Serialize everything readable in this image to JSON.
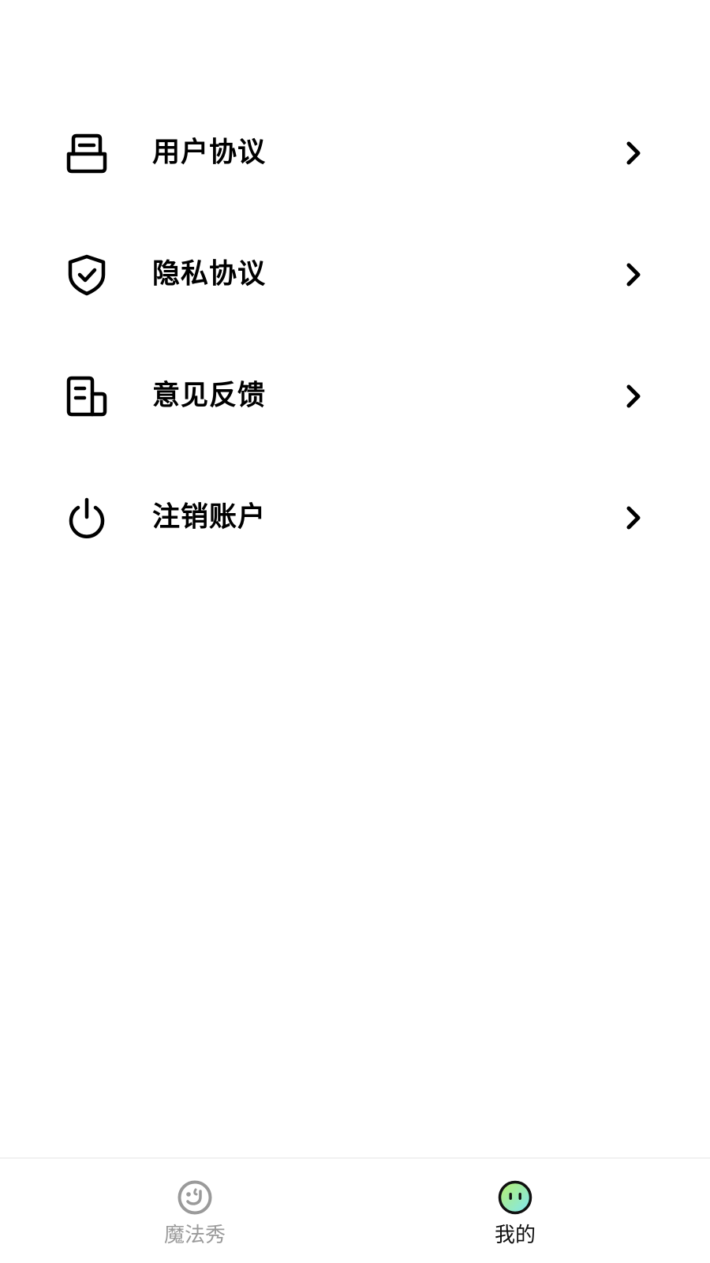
{
  "menu": {
    "items": [
      {
        "label": "用户协议",
        "icon": "inbox-icon"
      },
      {
        "label": "隐私协议",
        "icon": "shield-check-icon"
      },
      {
        "label": "意见反馈",
        "icon": "document-icon"
      },
      {
        "label": "注销账户",
        "icon": "power-icon"
      }
    ],
    "chevron_icon": "chevron-right-icon"
  },
  "tabbar": {
    "tabs": [
      {
        "label": "魔法秀",
        "icon": "face-smile-icon",
        "active": false
      },
      {
        "label": "我的",
        "icon": "face-gradient-icon",
        "active": true
      }
    ]
  },
  "colors": {
    "text_primary": "#000000",
    "tab_inactive": "#9a9a9a",
    "tab_active": "#111111",
    "accent_gradient_start": "#b7f06a",
    "accent_gradient_end": "#7fe6f7"
  }
}
